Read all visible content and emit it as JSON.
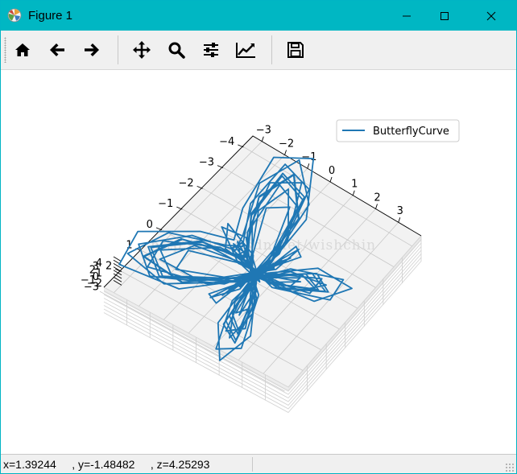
{
  "window": {
    "title": "Figure 1",
    "controls": [
      "minimize",
      "maximize",
      "close"
    ]
  },
  "toolbar": {
    "buttons": [
      {
        "id": "home",
        "icon": "home-icon"
      },
      {
        "id": "back",
        "icon": "arrow-left-icon"
      },
      {
        "id": "forward",
        "icon": "arrow-right-icon"
      },
      {
        "id": "pan",
        "icon": "move-icon"
      },
      {
        "id": "zoom",
        "icon": "zoom-icon"
      },
      {
        "id": "subplots",
        "icon": "sliders-icon"
      },
      {
        "id": "axes",
        "icon": "edit-axis-icon"
      },
      {
        "id": "save",
        "icon": "save-icon"
      }
    ]
  },
  "watermark": "http://blog.csdn.net/wishchin",
  "chart_data": {
    "type": "line",
    "projection": "3d",
    "series": [
      {
        "name": "ButterflyCurve",
        "color": "#1f77b4"
      }
    ],
    "legend_position": "top-right",
    "grid": true,
    "x_ticks": [
      "−4",
      "−3",
      "−2",
      "−1",
      "0",
      "1",
      "2"
    ],
    "y_ticks": [
      "−3",
      "−2",
      "−1",
      "0",
      "1",
      "2",
      "3"
    ],
    "z_ticks": [
      "4",
      "3",
      "2",
      "1",
      "0",
      "−1",
      "−2",
      "−3"
    ],
    "xlim": [
      -4,
      3
    ],
    "ylim": [
      -3,
      3
    ],
    "zlim": [
      -4,
      4
    ]
  },
  "status": {
    "text": "x=1.39244     , y=-1.48482     , z=4.25293"
  }
}
